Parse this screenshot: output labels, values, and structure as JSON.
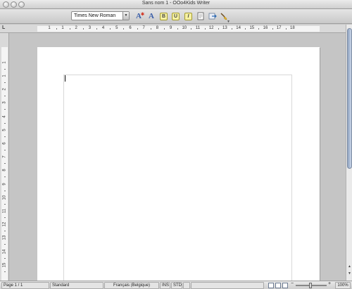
{
  "window": {
    "title": "Sans nom 1 - OOo4Kids Writer"
  },
  "toolbar": {
    "font_name": "Times New Roman",
    "icons": [
      "fontwork-icon",
      "character-icon",
      "bold-icon",
      "underline-icon",
      "italic-icon",
      "document-icon",
      "export-icon",
      "brush-icon"
    ],
    "bold_glyph": "B",
    "underline_glyph": "U",
    "italic_glyph": "I",
    "a_glyph": "A"
  },
  "ruler": {
    "horizontal_labels": [
      "1",
      "1",
      "2",
      "3",
      "4",
      "5",
      "6",
      "7",
      "8",
      "9",
      "10",
      "11",
      "12",
      "13",
      "14",
      "15",
      "16",
      "17",
      "18"
    ],
    "vertical_labels": [
      "1",
      "1",
      "2",
      "3",
      "4",
      "5",
      "6",
      "7",
      "8",
      "9",
      "10",
      "11",
      "12",
      "13",
      "14",
      "15"
    ],
    "tab_marker": "L"
  },
  "statusbar": {
    "page": "Page 1 / 1",
    "style": "Standard",
    "language": "Français (Belgique)",
    "insert_mode": "INS",
    "selection_mode": "STD",
    "zoom": "100%"
  },
  "colors": {
    "document_background": "#c5c5c5",
    "page": "#ffffff",
    "scroll_thumb": "#8fa3c1"
  }
}
